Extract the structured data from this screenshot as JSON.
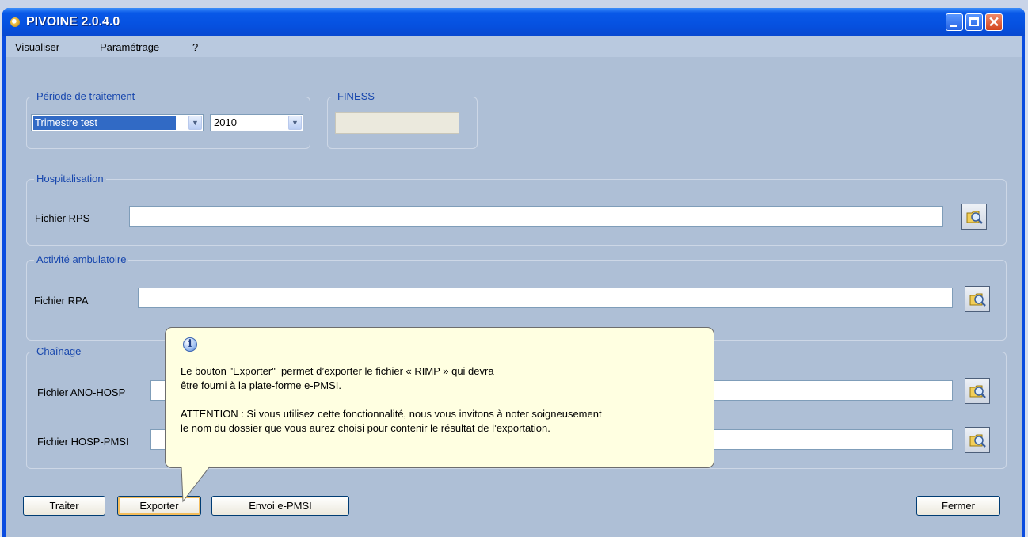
{
  "window": {
    "title": "PIVOINE 2.0.4.0"
  },
  "menu": [
    "Visualiser",
    "Paramétrage",
    "?"
  ],
  "periode": {
    "legend": "Période de traitement",
    "trimestre": "Trimestre test",
    "annee": "2010"
  },
  "finess": {
    "legend": "FINESS",
    "value": ""
  },
  "hospitalisation": {
    "legend": "Hospitalisation",
    "rps_label": "Fichier RPS",
    "rps_value": ""
  },
  "ambulatoire": {
    "legend": "Activité ambulatoire",
    "rpa_label": "Fichier RPA",
    "rpa_value": ""
  },
  "chainage": {
    "legend": "Chaînage",
    "ano_label": "Fichier ANO-HOSP",
    "ano_value": "",
    "hosp_label": "Fichier HOSP-PMSI",
    "hosp_value": ""
  },
  "buttons": {
    "traiter": "Traiter",
    "exporter": "Exporter",
    "envoi": "Envoi e-PMSI",
    "fermer": "Fermer"
  },
  "tooltip": {
    "icon": "info-icon",
    "line1": "Le bouton \"Exporter\"  permet d’exporter le fichier « RIMP » qui devra",
    "line2": "être fourni à la plate-forme e-PMSI.",
    "line3": "ATTENTION : Si vous utilisez cette fonctionnalité, nous vous invitons à noter soigneusement",
    "line4": "le nom du dossier que vous aurez choisi pour contenir le résultat de l’exportation."
  },
  "colors": {
    "titlebar": "#0651e0",
    "client": "#aebfd6",
    "legend": "#1746ad",
    "tooltip": "#ffffe1"
  }
}
